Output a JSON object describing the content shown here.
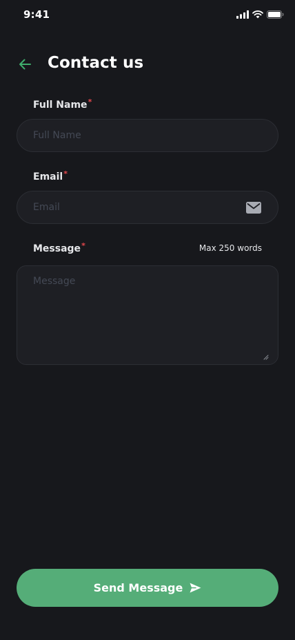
{
  "status_bar": {
    "time": "9:41"
  },
  "header": {
    "title": "Contact us"
  },
  "form": {
    "full_name": {
      "label": "Full Name",
      "required_mark": "*",
      "placeholder": "Full Name",
      "value": ""
    },
    "email": {
      "label": "Email",
      "required_mark": "*",
      "placeholder": "Email",
      "value": ""
    },
    "message": {
      "label": "Message",
      "required_mark": "*",
      "hint": "Max 250 words",
      "placeholder": "Message",
      "value": ""
    }
  },
  "send_button": {
    "label": "Send Message"
  },
  "colors": {
    "background": "#17181c",
    "input_background": "#1e1f24",
    "accent": "#55ad78",
    "back_arrow": "#3fae6c",
    "required": "#e5484d",
    "placeholder": "#444955"
  },
  "icons": {
    "back": "arrow-left-icon",
    "mail": "mail-icon",
    "send": "send-icon",
    "signal": "signal-icon",
    "wifi": "wifi-icon",
    "battery": "battery-icon"
  }
}
